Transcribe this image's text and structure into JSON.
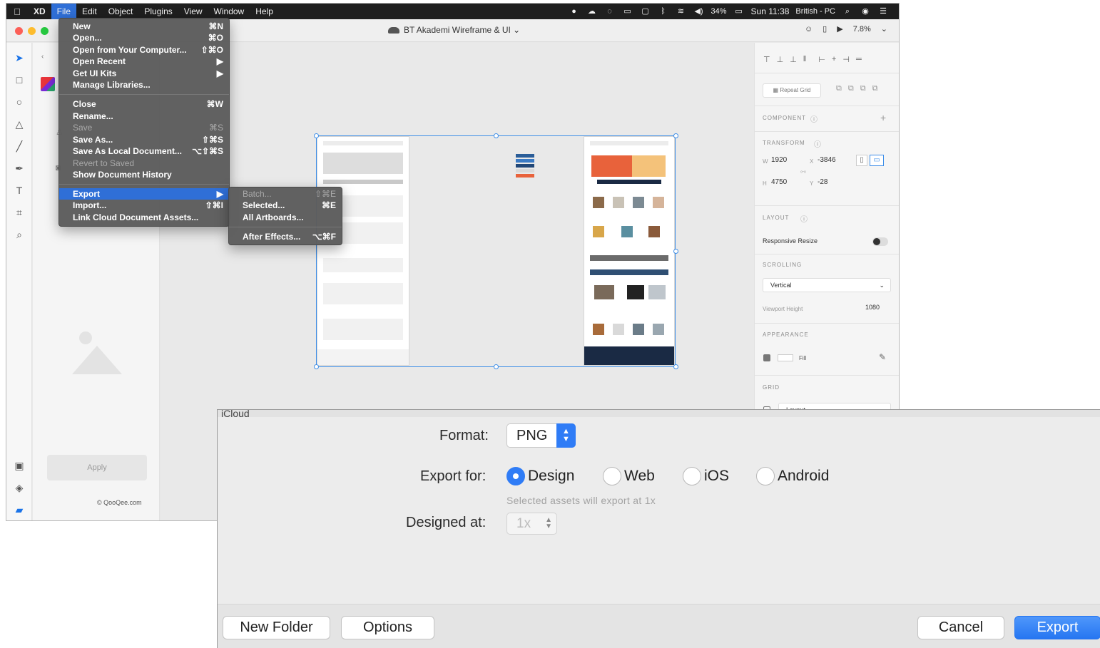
{
  "menubar": {
    "app": "XD",
    "items": [
      "File",
      "Edit",
      "Object",
      "Plugins",
      "View",
      "Window",
      "Help"
    ],
    "battery": "34%",
    "clock": "Sun 11:38",
    "input_source": "British - PC"
  },
  "window": {
    "title": "BT Akademi Wireframe & UI",
    "zoom": "7.8%"
  },
  "left_panel": {
    "apply_label": "Apply",
    "watermark": "QooQee.com"
  },
  "file_menu": {
    "items": [
      {
        "label": "New",
        "shortcut": "⌘N",
        "enabled": true
      },
      {
        "label": "Open...",
        "shortcut": "⌘O",
        "enabled": true
      },
      {
        "label": "Open from Your Computer...",
        "shortcut": "⇧⌘O",
        "enabled": true
      },
      {
        "label": "Open Recent",
        "shortcut": "▶",
        "enabled": true
      },
      {
        "label": "Get UI Kits",
        "shortcut": "▶",
        "enabled": true
      },
      {
        "label": "Manage Libraries...",
        "shortcut": "",
        "enabled": true
      },
      {
        "label": "Close",
        "shortcut": "⌘W",
        "enabled": true
      },
      {
        "label": "Rename...",
        "shortcut": "",
        "enabled": true
      },
      {
        "label": "Save",
        "shortcut": "⌘S",
        "enabled": false
      },
      {
        "label": "Save As...",
        "shortcut": "⇧⌘S",
        "enabled": true
      },
      {
        "label": "Save As Local Document...",
        "shortcut": "⌥⇧⌘S",
        "enabled": true
      },
      {
        "label": "Revert to Saved",
        "shortcut": "",
        "enabled": false
      },
      {
        "label": "Show Document History",
        "shortcut": "",
        "enabled": true
      },
      {
        "label": "Export",
        "shortcut": "▶",
        "enabled": true
      },
      {
        "label": "Import...",
        "shortcut": "⇧⌘I",
        "enabled": true
      },
      {
        "label": "Link Cloud Document Assets...",
        "shortcut": "",
        "enabled": true
      }
    ]
  },
  "export_submenu": {
    "items": [
      {
        "label": "Batch...",
        "shortcut": "⇧⌘E",
        "enabled": false
      },
      {
        "label": "Selected...",
        "shortcut": "⌘E",
        "enabled": true
      },
      {
        "label": "All Artboards...",
        "shortcut": "",
        "enabled": true
      },
      {
        "label": "After Effects...",
        "shortcut": "⌥⌘F",
        "enabled": true
      }
    ]
  },
  "right_panel": {
    "repeat_grid": "Repeat Grid",
    "component_label": "COMPONENT",
    "transform_label": "TRANSFORM",
    "w_label": "W",
    "w": "1920",
    "x_label": "X",
    "x": "-3846",
    "h_label": "H",
    "h": "4750",
    "y_label": "Y",
    "y": "-28",
    "layout_label": "LAYOUT",
    "responsive_resize": "Responsive Resize",
    "scrolling_label": "SCROLLING",
    "scrolling_value": "Vertical",
    "viewport_height_label": "Viewport Height",
    "viewport_height": "1080",
    "appearance_label": "APPEARANCE",
    "fill_label": "Fill",
    "grid_label": "GRID",
    "grid_value": "Layout"
  },
  "export_dialog": {
    "location": "iCloud",
    "format_label": "Format:",
    "format_value": "PNG",
    "export_for_label": "Export for:",
    "options": [
      "Design",
      "Web",
      "iOS",
      "Android"
    ],
    "selected_option": "Design",
    "hint": "Selected assets will export at 1x",
    "designed_at_label": "Designed at:",
    "designed_at_value": "1x",
    "new_folder": "New Folder",
    "options_button": "Options",
    "cancel": "Cancel",
    "export": "Export"
  }
}
